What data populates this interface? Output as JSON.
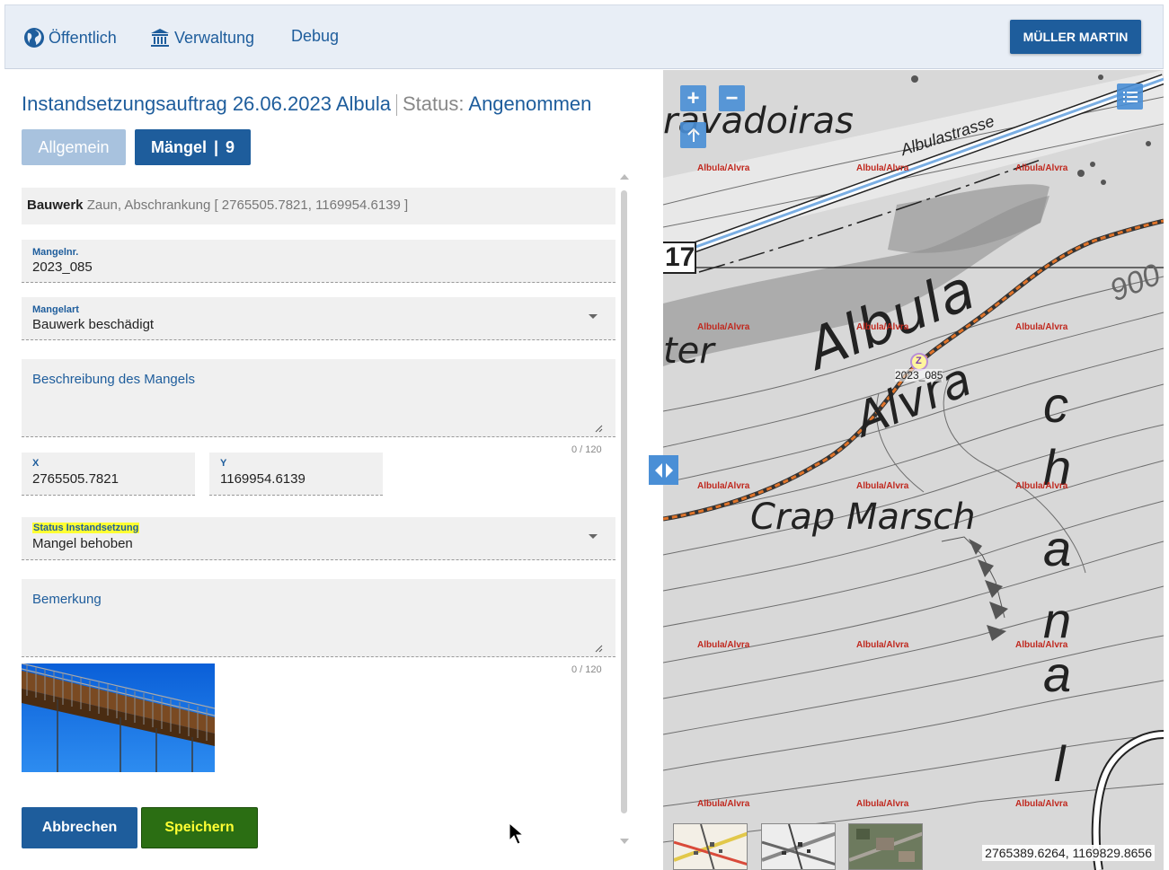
{
  "nav": {
    "public": "Öffentlich",
    "admin": "Verwaltung",
    "debug": "Debug",
    "user": "MÜLLER MARTIN"
  },
  "header": {
    "title": "Instandsetzungsauftrag 26.06.2023 Albula",
    "status_label": "Status:",
    "status_value": "Angenommen"
  },
  "tabs": {
    "general": "Allgemein",
    "defects": "Mängel",
    "defects_count": "9"
  },
  "form": {
    "bauwerk_label": "Bauwerk",
    "bauwerk_value": "Zaun, Abschrankung [ 2765505.7821, 1169954.6139 ]",
    "mangelnr_label": "Mangelnr.",
    "mangelnr_value": "2023_085",
    "mangelart_label": "Mangelart",
    "mangelart_value": "Bauwerk beschädigt",
    "beschreibung_label": "Beschreibung des Mangels",
    "beschreibung_counter": "0 / 120",
    "x_label": "X",
    "x_value": "2765505.7821",
    "y_label": "Y",
    "y_value": "1169954.6139",
    "status_label": "Status Instandsetzung",
    "status_value": "Mangel behoben",
    "bemerkung_label": "Bemerkung",
    "bemerkung_counter": "0 / 120"
  },
  "buttons": {
    "cancel": "Abbrechen",
    "save": "Speichern"
  },
  "map": {
    "place_gravadoiras": "ravadoiras",
    "place_albulastrasse": "Albulastrasse",
    "place_albula": "Albula",
    "place_alvra": "Alvra",
    "place_ster": "ter",
    "place_crap_marsch": "Crap Marsch",
    "place_chanal": "c h a n a l",
    "contour_900": "900",
    "route_17": "17",
    "district_label": "Albula/Alvra",
    "marker_letter": "Z",
    "marker_label": "2023_085",
    "coordinates": "2765389.6264, 1169829.8656",
    "accent_color": "#4a8fd6"
  }
}
